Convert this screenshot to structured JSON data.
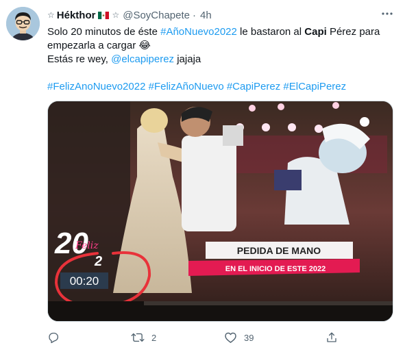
{
  "tweet": {
    "author": {
      "name": "Hékthor",
      "star_before": "☆",
      "star_after": "☆",
      "handle": "@SoyChapete",
      "separator": "·",
      "time": "4h"
    },
    "text": {
      "line1_pre": "Solo 20 minutos de éste ",
      "line1_tag": "#AñoNuevo2022",
      "line1_mid": " le bastaron al ",
      "line1_bold": "Capi",
      "line1_post": " Pérez para",
      "line2": "empezarla a cargar ",
      "line2_emoji": "😂",
      "line3_pre": "Estás re wey, ",
      "line3_mention": "@elcapiperez",
      "line3_post": " jajaja",
      "hashtags": [
        "#FelizAnoNuevo2022",
        "#FelizAñoNuevo",
        "#CapiPerez",
        "#ElCapiPerez"
      ]
    },
    "media": {
      "logo_number": "20",
      "logo_script": "Feliz",
      "logo_sub": "2",
      "timer": "00:20",
      "banner_title": "PEDIDA DE MANO",
      "banner_subtitle": "EN EL INICIO DE ESTE 2022"
    },
    "actions": {
      "reply_count": "",
      "retweet_count": "2",
      "like_count": "39"
    },
    "colors": {
      "link": "#1d9bf0",
      "secondary": "#536471",
      "circle": "#e8323a"
    }
  }
}
